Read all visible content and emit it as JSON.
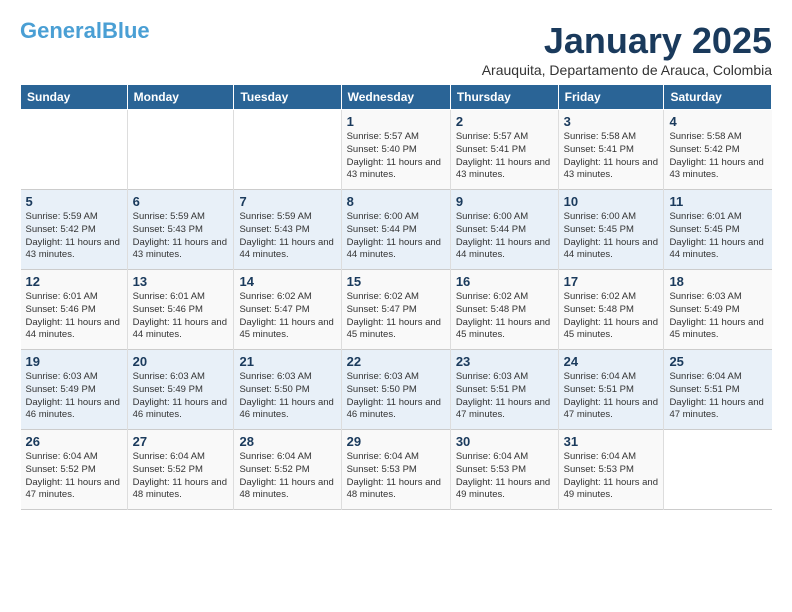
{
  "header": {
    "logo_main": "General",
    "logo_accent": "Blue",
    "title": "January 2025",
    "subtitle": "Arauquita, Departamento de Arauca, Colombia"
  },
  "days_of_week": [
    "Sunday",
    "Monday",
    "Tuesday",
    "Wednesday",
    "Thursday",
    "Friday",
    "Saturday"
  ],
  "weeks": [
    [
      {
        "day": "",
        "info": ""
      },
      {
        "day": "",
        "info": ""
      },
      {
        "day": "",
        "info": ""
      },
      {
        "day": "1",
        "info": "Sunrise: 5:57 AM\nSunset: 5:40 PM\nDaylight: 11 hours\nand 43 minutes."
      },
      {
        "day": "2",
        "info": "Sunrise: 5:57 AM\nSunset: 5:41 PM\nDaylight: 11 hours\nand 43 minutes."
      },
      {
        "day": "3",
        "info": "Sunrise: 5:58 AM\nSunset: 5:41 PM\nDaylight: 11 hours\nand 43 minutes."
      },
      {
        "day": "4",
        "info": "Sunrise: 5:58 AM\nSunset: 5:42 PM\nDaylight: 11 hours\nand 43 minutes."
      }
    ],
    [
      {
        "day": "5",
        "info": "Sunrise: 5:59 AM\nSunset: 5:42 PM\nDaylight: 11 hours\nand 43 minutes."
      },
      {
        "day": "6",
        "info": "Sunrise: 5:59 AM\nSunset: 5:43 PM\nDaylight: 11 hours\nand 43 minutes."
      },
      {
        "day": "7",
        "info": "Sunrise: 5:59 AM\nSunset: 5:43 PM\nDaylight: 11 hours\nand 44 minutes."
      },
      {
        "day": "8",
        "info": "Sunrise: 6:00 AM\nSunset: 5:44 PM\nDaylight: 11 hours\nand 44 minutes."
      },
      {
        "day": "9",
        "info": "Sunrise: 6:00 AM\nSunset: 5:44 PM\nDaylight: 11 hours\nand 44 minutes."
      },
      {
        "day": "10",
        "info": "Sunrise: 6:00 AM\nSunset: 5:45 PM\nDaylight: 11 hours\nand 44 minutes."
      },
      {
        "day": "11",
        "info": "Sunrise: 6:01 AM\nSunset: 5:45 PM\nDaylight: 11 hours\nand 44 minutes."
      }
    ],
    [
      {
        "day": "12",
        "info": "Sunrise: 6:01 AM\nSunset: 5:46 PM\nDaylight: 11 hours\nand 44 minutes."
      },
      {
        "day": "13",
        "info": "Sunrise: 6:01 AM\nSunset: 5:46 PM\nDaylight: 11 hours\nand 44 minutes."
      },
      {
        "day": "14",
        "info": "Sunrise: 6:02 AM\nSunset: 5:47 PM\nDaylight: 11 hours\nand 45 minutes."
      },
      {
        "day": "15",
        "info": "Sunrise: 6:02 AM\nSunset: 5:47 PM\nDaylight: 11 hours\nand 45 minutes."
      },
      {
        "day": "16",
        "info": "Sunrise: 6:02 AM\nSunset: 5:48 PM\nDaylight: 11 hours\nand 45 minutes."
      },
      {
        "day": "17",
        "info": "Sunrise: 6:02 AM\nSunset: 5:48 PM\nDaylight: 11 hours\nand 45 minutes."
      },
      {
        "day": "18",
        "info": "Sunrise: 6:03 AM\nSunset: 5:49 PM\nDaylight: 11 hours\nand 45 minutes."
      }
    ],
    [
      {
        "day": "19",
        "info": "Sunrise: 6:03 AM\nSunset: 5:49 PM\nDaylight: 11 hours\nand 46 minutes."
      },
      {
        "day": "20",
        "info": "Sunrise: 6:03 AM\nSunset: 5:49 PM\nDaylight: 11 hours\nand 46 minutes."
      },
      {
        "day": "21",
        "info": "Sunrise: 6:03 AM\nSunset: 5:50 PM\nDaylight: 11 hours\nand 46 minutes."
      },
      {
        "day": "22",
        "info": "Sunrise: 6:03 AM\nSunset: 5:50 PM\nDaylight: 11 hours\nand 46 minutes."
      },
      {
        "day": "23",
        "info": "Sunrise: 6:03 AM\nSunset: 5:51 PM\nDaylight: 11 hours\nand 47 minutes."
      },
      {
        "day": "24",
        "info": "Sunrise: 6:04 AM\nSunset: 5:51 PM\nDaylight: 11 hours\nand 47 minutes."
      },
      {
        "day": "25",
        "info": "Sunrise: 6:04 AM\nSunset: 5:51 PM\nDaylight: 11 hours\nand 47 minutes."
      }
    ],
    [
      {
        "day": "26",
        "info": "Sunrise: 6:04 AM\nSunset: 5:52 PM\nDaylight: 11 hours\nand 47 minutes."
      },
      {
        "day": "27",
        "info": "Sunrise: 6:04 AM\nSunset: 5:52 PM\nDaylight: 11 hours\nand 48 minutes."
      },
      {
        "day": "28",
        "info": "Sunrise: 6:04 AM\nSunset: 5:52 PM\nDaylight: 11 hours\nand 48 minutes."
      },
      {
        "day": "29",
        "info": "Sunrise: 6:04 AM\nSunset: 5:53 PM\nDaylight: 11 hours\nand 48 minutes."
      },
      {
        "day": "30",
        "info": "Sunrise: 6:04 AM\nSunset: 5:53 PM\nDaylight: 11 hours\nand 49 minutes."
      },
      {
        "day": "31",
        "info": "Sunrise: 6:04 AM\nSunset: 5:53 PM\nDaylight: 11 hours\nand 49 minutes."
      },
      {
        "day": "",
        "info": ""
      }
    ]
  ]
}
